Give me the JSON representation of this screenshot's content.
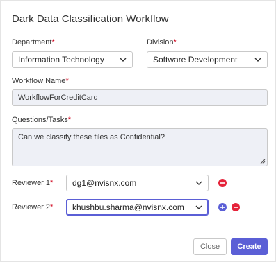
{
  "dialog": {
    "title": "Dark Data Classification Workflow"
  },
  "department": {
    "label": "Department",
    "required_mark": "*",
    "value": "Information Technology"
  },
  "division": {
    "label": "Division",
    "required_mark": "*",
    "value": "Software Development"
  },
  "workflow_name": {
    "label": "Workflow Name",
    "required_mark": "*",
    "value": "WorkflowForCreditCard"
  },
  "questions": {
    "label": "Questions/Tasks",
    "required_mark": "*",
    "value": "Can we classify these files as Confidential?"
  },
  "reviewers": [
    {
      "label": "Reviewer 1",
      "required_mark": "*",
      "value": "dg1@nvisnx.com"
    },
    {
      "label": "Reviewer 2",
      "required_mark": "*",
      "value": "khushbu.sharma@nvisnx.com"
    }
  ],
  "footer": {
    "close_label": "Close",
    "create_label": "Create"
  },
  "colors": {
    "accent": "#5b5fd6",
    "danger": "#e5233a",
    "required": "#d0021b",
    "readonly_bg": "#eef0f6"
  },
  "icons": {
    "select_arrow": "chevron-down-icon",
    "remove": "minus-circle-icon",
    "add": "plus-circle-icon",
    "resize": "resize-grip-icon"
  }
}
